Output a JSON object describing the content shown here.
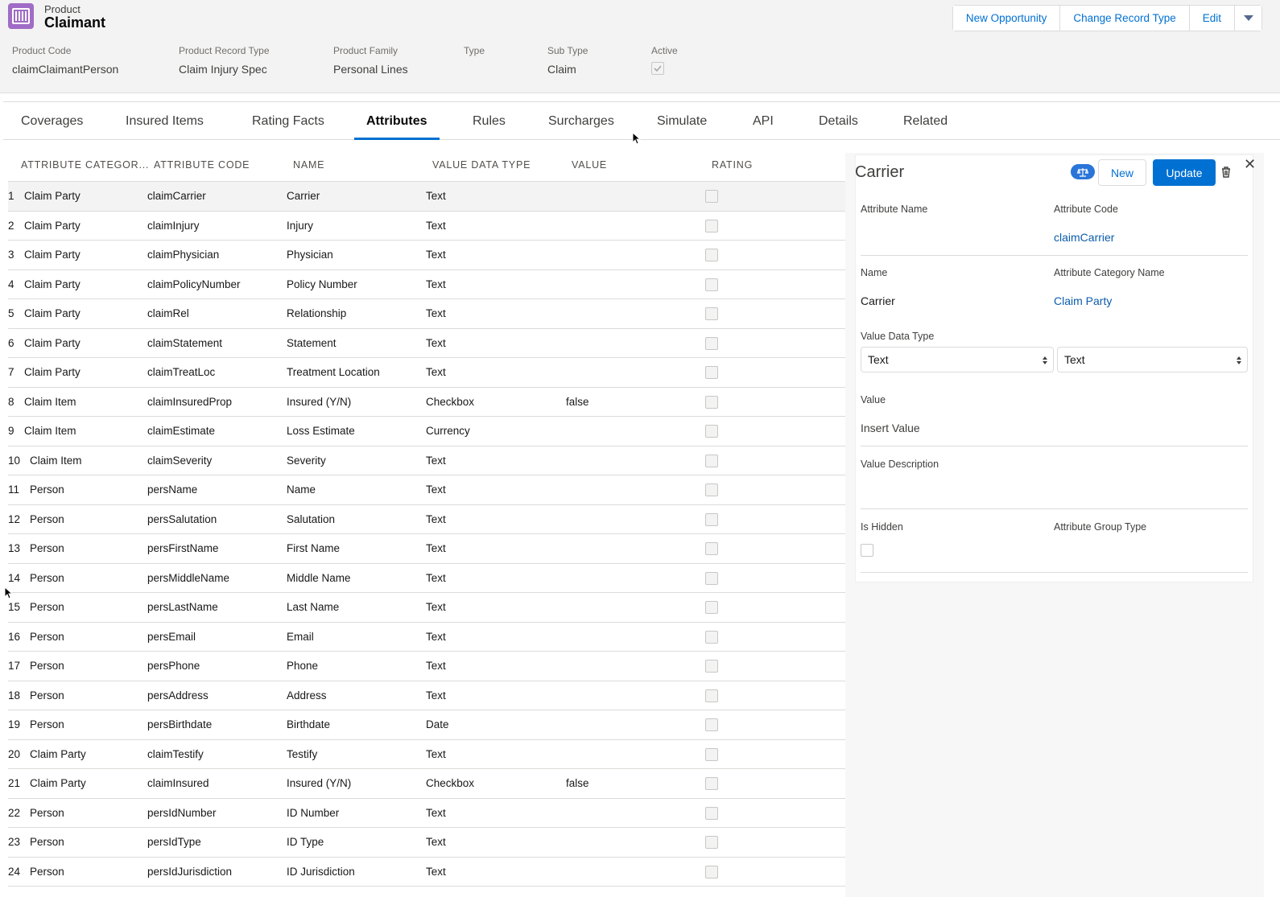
{
  "header": {
    "object_type": "Product",
    "record_name": "Claimant",
    "actions": [
      "New Opportunity",
      "Change Record Type",
      "Edit"
    ],
    "fields": [
      {
        "label": "Product Code",
        "value": "claimClaimantPerson"
      },
      {
        "label": "Product Record Type",
        "value": "Claim Injury Spec"
      },
      {
        "label": "Product Family",
        "value": "Personal Lines"
      },
      {
        "label": "Type",
        "value": ""
      },
      {
        "label": "Sub Type",
        "value": "Claim"
      },
      {
        "label": "Active",
        "value": ""
      }
    ]
  },
  "tabs": [
    "Coverages",
    "Insured Items",
    "Rating Facts",
    "Attributes",
    "Rules",
    "Surcharges",
    "Simulate",
    "API",
    "Details",
    "Related"
  ],
  "active_tab": "Attributes",
  "table": {
    "columns": [
      "ATTRIBUTE CATEGOR...",
      "ATTRIBUTE CODE",
      "NAME",
      "VALUE DATA TYPE",
      "VALUE",
      "RATING"
    ],
    "rows": [
      {
        "num": "1",
        "category": "Claim Party",
        "code": "claimCarrier",
        "name": "Carrier",
        "type": "Text",
        "value": ""
      },
      {
        "num": "2",
        "category": "Claim Party",
        "code": "claimInjury",
        "name": "Injury",
        "type": "Text",
        "value": ""
      },
      {
        "num": "3",
        "category": "Claim Party",
        "code": "claimPhysician",
        "name": "Physician",
        "type": "Text",
        "value": ""
      },
      {
        "num": "4",
        "category": "Claim Party",
        "code": "claimPolicyNumber",
        "name": "Policy Number",
        "type": "Text",
        "value": ""
      },
      {
        "num": "5",
        "category": "Claim Party",
        "code": "claimRel",
        "name": "Relationship",
        "type": "Text",
        "value": ""
      },
      {
        "num": "6",
        "category": "Claim Party",
        "code": "claimStatement",
        "name": "Statement",
        "type": "Text",
        "value": ""
      },
      {
        "num": "7",
        "category": "Claim Party",
        "code": "claimTreatLoc",
        "name": "Treatment Location",
        "type": "Text",
        "value": ""
      },
      {
        "num": "8",
        "category": "Claim Item",
        "code": "claimInsuredProp",
        "name": "Insured (Y/N)",
        "type": "Checkbox",
        "value": "false"
      },
      {
        "num": "9",
        "category": "Claim Item",
        "code": "claimEstimate",
        "name": "Loss Estimate",
        "type": "Currency",
        "value": ""
      },
      {
        "num": "10",
        "category": "Claim Item",
        "code": "claimSeverity",
        "name": "Severity",
        "type": "Text",
        "value": ""
      },
      {
        "num": "11",
        "category": "Person",
        "code": "persName",
        "name": "Name",
        "type": "Text",
        "value": ""
      },
      {
        "num": "12",
        "category": "Person",
        "code": "persSalutation",
        "name": "Salutation",
        "type": "Text",
        "value": ""
      },
      {
        "num": "13",
        "category": "Person",
        "code": "persFirstName",
        "name": "First Name",
        "type": "Text",
        "value": ""
      },
      {
        "num": "14",
        "category": "Person",
        "code": "persMiddleName",
        "name": "Middle Name",
        "type": "Text",
        "value": ""
      },
      {
        "num": "15",
        "category": "Person",
        "code": "persLastName",
        "name": "Last Name",
        "type": "Text",
        "value": ""
      },
      {
        "num": "16",
        "category": "Person",
        "code": "persEmail",
        "name": "Email",
        "type": "Text",
        "value": ""
      },
      {
        "num": "17",
        "category": "Person",
        "code": "persPhone",
        "name": "Phone",
        "type": "Text",
        "value": ""
      },
      {
        "num": "18",
        "category": "Person",
        "code": "persAddress",
        "name": "Address",
        "type": "Text",
        "value": ""
      },
      {
        "num": "19",
        "category": "Person",
        "code": "persBirthdate",
        "name": "Birthdate",
        "type": "Date",
        "value": ""
      },
      {
        "num": "20",
        "category": "Claim Party",
        "code": "claimTestify",
        "name": "Testify",
        "type": "Text",
        "value": ""
      },
      {
        "num": "21",
        "category": "Claim Party",
        "code": "claimInsured",
        "name": "Insured (Y/N)",
        "type": "Checkbox",
        "value": "false"
      },
      {
        "num": "22",
        "category": "Person",
        "code": "persIdNumber",
        "name": "ID Number",
        "type": "Text",
        "value": ""
      },
      {
        "num": "23",
        "category": "Person",
        "code": "persIdType",
        "name": "ID Type",
        "type": "Text",
        "value": ""
      },
      {
        "num": "24",
        "category": "Person",
        "code": "persIdJurisdiction",
        "name": "ID Jurisdiction",
        "type": "Text",
        "value": ""
      }
    ]
  },
  "panel": {
    "title": "Carrier",
    "new_label": "New",
    "update_label": "Update",
    "attribute_name_label": "Attribute Name",
    "attribute_code_label": "Attribute Code",
    "attribute_code_value": "claimCarrier",
    "name_label": "Name",
    "name_value": "Carrier",
    "category_label": "Attribute Category Name",
    "category_value": "Claim Party",
    "data_type_label": "Value Data Type",
    "data_type_select_1": "Text",
    "data_type_select_2": "Text",
    "value_label": "Value",
    "value_placeholder": "Insert Value",
    "description_label": "Value Description",
    "hidden_label": "Is Hidden",
    "group_type_label": "Attribute Group Type"
  },
  "colors": {
    "brand": "#0070d2",
    "product_icon": "#a06cc6"
  }
}
